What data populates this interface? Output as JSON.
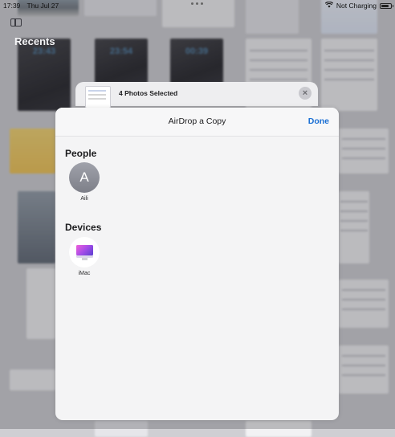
{
  "status_bar": {
    "time": "17:39",
    "date": "Thu Jul 27",
    "charging_text": "Not Charging",
    "battery_level": 0.8
  },
  "library": {
    "section_title": "Recents",
    "lockscreen_times": [
      "23:43",
      "23:54",
      "00:39"
    ]
  },
  "share_sheet": {
    "header_title": "4 Photos Selected",
    "close_icon": "×"
  },
  "airdrop": {
    "title": "AirDrop a Copy",
    "done_label": "Done",
    "people_heading": "People",
    "people": [
      {
        "initial": "A",
        "name": "Aili"
      }
    ],
    "devices_heading": "Devices",
    "devices": [
      {
        "name": "iMac",
        "icon": "imac-icon"
      }
    ]
  },
  "colors": {
    "accent": "#1a6fd4",
    "avatar": "#8e9099"
  }
}
